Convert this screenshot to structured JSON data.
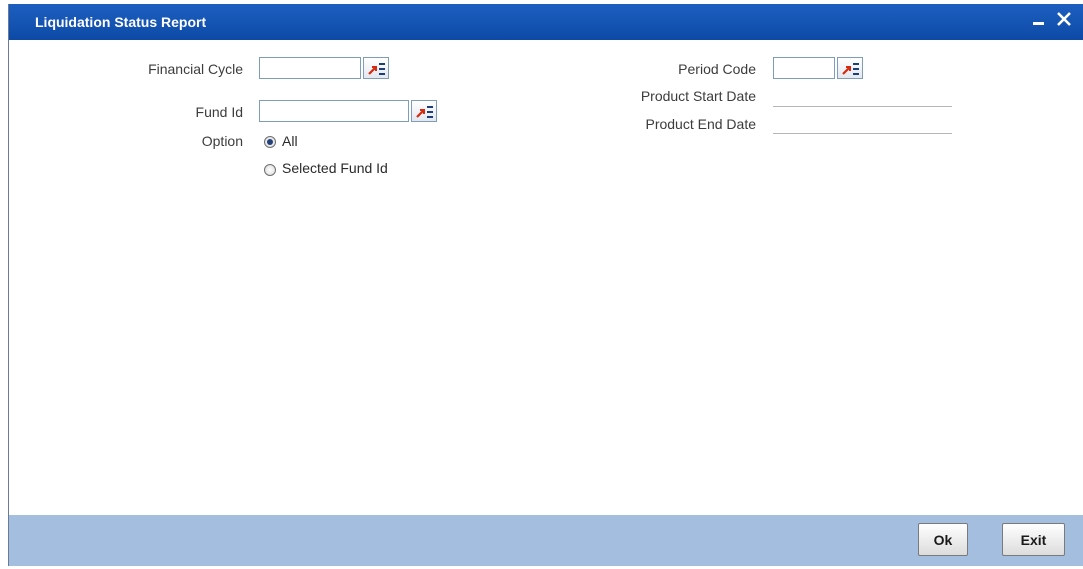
{
  "window": {
    "title": "Liquidation Status Report",
    "minimize_glyph": "‗",
    "close_glyph": "✕"
  },
  "form": {
    "financial_cycle": {
      "label": "Financial Cycle",
      "value": ""
    },
    "fund_id": {
      "label": "Fund Id",
      "value": ""
    },
    "option": {
      "label": "Option",
      "choices": [
        {
          "label": "All",
          "checked": true
        },
        {
          "label": "Selected Fund Id",
          "checked": false
        }
      ]
    },
    "period_code": {
      "label": "Period Code",
      "value": ""
    },
    "product_start_date": {
      "label": "Product Start Date",
      "value": ""
    },
    "product_end_date": {
      "label": "Product End Date",
      "value": ""
    }
  },
  "footer": {
    "ok_label": "Ok",
    "exit_label": "Exit"
  },
  "colors": {
    "titlebar": "#0d4aa6",
    "footer": "#a4bedf"
  },
  "icons": {
    "lov": "list-of-values-icon",
    "minimize": "minimize-icon",
    "close": "close-icon"
  }
}
